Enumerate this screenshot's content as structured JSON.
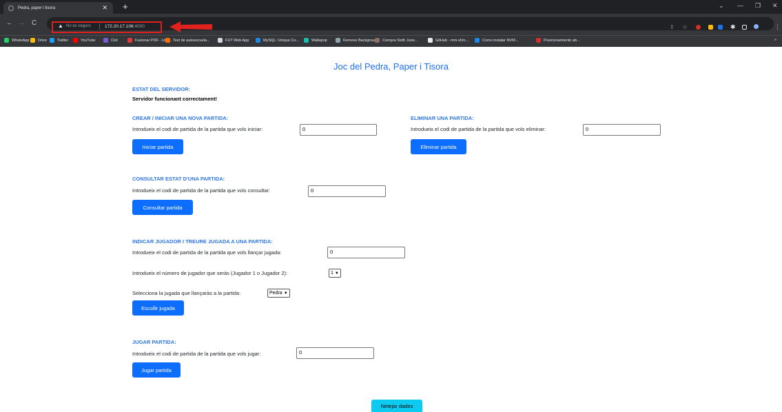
{
  "browser": {
    "tab_title": "Pedra, paper i tisora",
    "new_tab": "+",
    "insecure_label": "No es seguro",
    "url_host": "172.20.17.106",
    "url_port": ":4000",
    "bookmarks": [
      {
        "label": "WhatsApp",
        "color": "#25d366"
      },
      {
        "label": "Drive",
        "color": "#fbbc04"
      },
      {
        "label": "Twitter",
        "color": "#1da1f2"
      },
      {
        "label": "YouTube",
        "color": "#ff0000"
      },
      {
        "label": "Clot",
        "color": "#7b5cd6"
      },
      {
        "label": "Fusionar PDF - Unir...",
        "color": "#e53935"
      },
      {
        "label": "Test de autoescuela...",
        "color": "#ff6f00"
      },
      {
        "label": "FUT Web App",
        "color": "#cfd8dc"
      },
      {
        "label": "MySQL: Unique Co...",
        "color": "#1e88e5"
      },
      {
        "label": "Wallapop",
        "color": "#13c1ac"
      },
      {
        "label": "Remove Backgroun...",
        "color": "#90a4ae"
      },
      {
        "label": "Compra Sixth June...",
        "color": "#8d6e63"
      },
      {
        "label": "GitHub - mm-sh/n...",
        "color": "#e8eaed"
      },
      {
        "label": "Como instalar NVM...",
        "color": "#1e88e5"
      },
      {
        "label": "Posicionamiento ab...",
        "color": "#d32f2f"
      }
    ],
    "more_bookmarks": "»"
  },
  "page": {
    "title": "Joc del Pedra, Paper i Tisora",
    "status": {
      "heading": "ESTAT DEL SERVIDOR:",
      "text": "Servidor funcionant correctament!"
    },
    "create": {
      "heading": "CREAR / INICIAR UNA NOVA PARTIDA:",
      "label": "Introdueix el codi de partida de la partida que vols iniciar:",
      "value": "0",
      "button": "Iniciar partida"
    },
    "delete": {
      "heading": "ELIMINAR UNA PARTIDA:",
      "label": "Introdueix el codi de partida de la partida que vols eliminar:",
      "value": "0",
      "button": "Eliminar partida"
    },
    "query": {
      "heading": "CONSULTAR ESTAT D'UNA PARTIDA:",
      "label": "Introdueix el codi de partida de la partida que vols consultar:",
      "value": "0",
      "button": "Consultar partida"
    },
    "move": {
      "heading": "INDICAR JUGADOR I TREURE JUGADA A UNA PARTIDA:",
      "label": "Introdueix el codi de partida de la partida que vols llançar jugada:",
      "value": "0",
      "player_label": "Introdueix el número de jugador que seràs (Jugador 1 o Jugador 2):",
      "player_value": "1",
      "play_label": "Selecciona la jugada que llançaràs a la partida:",
      "play_value": "Pedra",
      "button": "Escollir jugada"
    },
    "play": {
      "heading": "JUGAR PARTIDA:",
      "label": "Introdueix el codi de partida de la partida que vols jugar:",
      "value": "0",
      "button": "Jugar partida"
    },
    "clear_button": "Netejar dades"
  }
}
